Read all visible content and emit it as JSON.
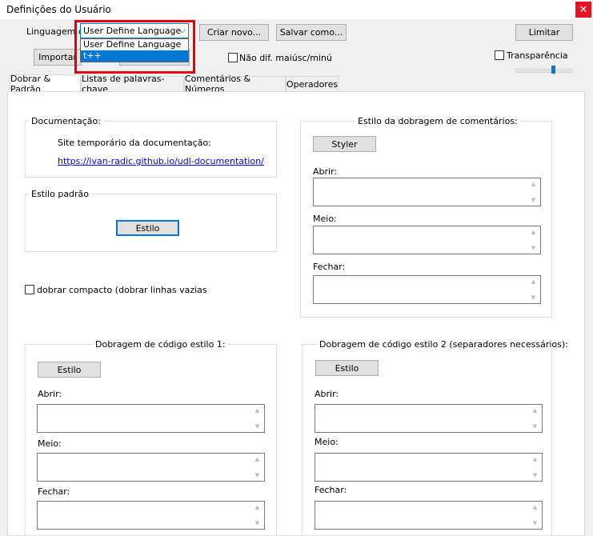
{
  "window": {
    "title": "Definições do Usuário",
    "close": "✕"
  },
  "toolbar": {
    "language_label": "Linguagem do",
    "language_selected": "User Define Language",
    "language_options": [
      "User Define Language",
      "t++"
    ],
    "import_label": "Importar",
    "new_label": "Criar novo...",
    "save_as_label": "Salvar como...",
    "limit_label": "Limitar",
    "case_label": "Não dif. maiúsc/minú",
    "transparency_label": "Transparência",
    "transparency_level": 0.7
  },
  "tabs": [
    {
      "label": "Dobrar & Padrão",
      "active": true
    },
    {
      "label": "Listas de palavras-chave",
      "active": false
    },
    {
      "label": "Comentários & Números",
      "active": false
    },
    {
      "label": "Operadores",
      "active": false
    }
  ],
  "documentation": {
    "title": "Documentação:",
    "temp_site": "Site temporário da documentação:",
    "link": "https://ivan-radic.github.io/udl-documentation/"
  },
  "default_style": {
    "title": "Estilo padrão",
    "button": "Estilo"
  },
  "compact_fold": {
    "label": "dobrar compacto (dobrar linhas vazias tambe"
  },
  "comment_fold": {
    "title": "Estilo da dobragem de comentários:",
    "button": "Styler",
    "open": "Abrir:",
    "middle": "Meio:",
    "close": "Fechar:"
  },
  "code_fold_1": {
    "title": "Dobragem de código estilo 1:",
    "button": "Estilo",
    "open": "Abrir:",
    "middle": "Meio:",
    "close": "Fechar:"
  },
  "code_fold_2": {
    "title": "Dobragem de código estilo 2 (separadores necessários):",
    "button": "Estilo",
    "open": "Abrir:",
    "middle": "Meio:",
    "close": "Fechar:"
  }
}
